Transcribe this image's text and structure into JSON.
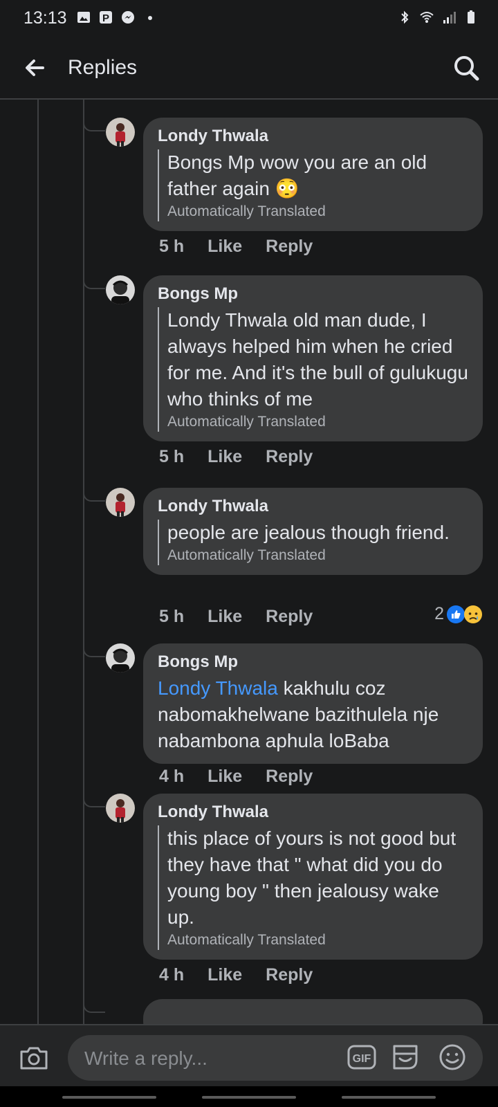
{
  "status_bar": {
    "time": "13:13"
  },
  "header": {
    "title": "Replies"
  },
  "comments": [
    {
      "author": "Londy Thwala",
      "text": "Bongs Mp wow you are an old father again 😳",
      "translated_label": "Automatically Translated",
      "time": "5 h",
      "like_label": "Like",
      "reply_label": "Reply"
    },
    {
      "author": "Bongs Mp",
      "text": "Londy Thwala old man dude, I always helped him when he cried for me. And it's the bull of gulukugu who thinks of me",
      "translated_label": "Automatically Translated",
      "time": "5 h",
      "like_label": "Like",
      "reply_label": "Reply"
    },
    {
      "author": "Londy Thwala",
      "text": "people are jealous though friend.",
      "translated_label": "Automatically Translated",
      "time": "5 h",
      "like_label": "Like",
      "reply_label": "Reply",
      "reaction_count": "2"
    },
    {
      "author": "Bongs Mp",
      "mention": "Londy Thwala",
      "text": " kakhulu coz nabomakhelwane bazithulela nje nabambona aphula loBaba",
      "time": "4 h",
      "like_label": "Like",
      "reply_label": "Reply"
    },
    {
      "author": "Londy Thwala",
      "text": "this place of yours is not good but they have that \" what did you do young boy \" then jealousy wake up.",
      "translated_label": "Automatically Translated",
      "time": "4 h",
      "like_label": "Like",
      "reply_label": "Reply"
    }
  ],
  "composer": {
    "placeholder": "Write a reply...",
    "gif_label": "GIF"
  },
  "colors": {
    "background": "#18191a",
    "bubble": "#3a3b3c",
    "mention": "#4599ff",
    "like_reaction": "#1877f2"
  },
  "icons": [
    "back-arrow-icon",
    "search-icon",
    "camera-icon",
    "gif-icon",
    "sticker-icon",
    "emoji-icon",
    "like-reaction-icon",
    "sad-reaction-icon"
  ]
}
